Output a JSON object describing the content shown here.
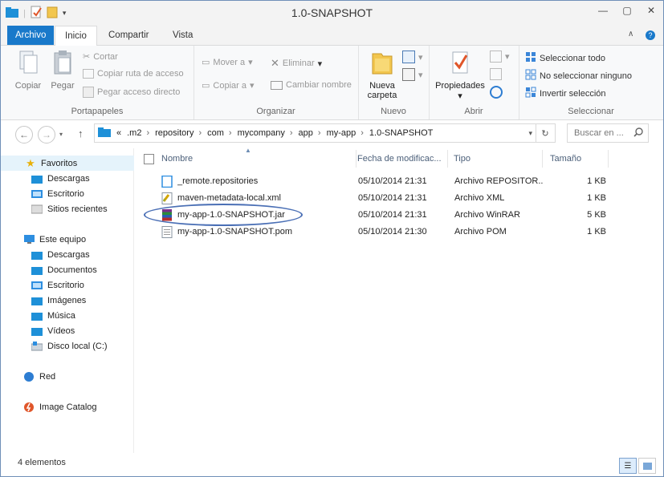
{
  "window": {
    "title": "1.0-SNAPSHOT"
  },
  "ribbon_tabs": {
    "file": "Archivo",
    "home": "Inicio",
    "share": "Compartir",
    "view": "Vista"
  },
  "ribbon": {
    "clipboard": {
      "copy": "Copiar",
      "paste": "Pegar",
      "cut": "Cortar",
      "copy_path": "Copiar ruta de acceso",
      "paste_shortcut": "Pegar acceso directo",
      "label": "Portapapeles"
    },
    "organize": {
      "move_to": "Mover a",
      "copy_to": "Copiar a",
      "delete": "Eliminar",
      "rename": "Cambiar nombre",
      "label": "Organizar"
    },
    "new": {
      "new_folder_line1": "Nueva",
      "new_folder_line2": "carpeta",
      "label": "Nuevo"
    },
    "open": {
      "properties": "Propiedades",
      "label": "Abrir"
    },
    "select": {
      "select_all": "Seleccionar todo",
      "select_none": "No seleccionar ninguno",
      "invert": "Invertir selección",
      "label": "Seleccionar"
    }
  },
  "address": {
    "overflow": "«",
    "crumbs": [
      ".m2",
      "repository",
      "com",
      "mycompany",
      "app",
      "my-app",
      "1.0-SNAPSHOT"
    ],
    "search_placeholder": "Buscar en ..."
  },
  "nav": {
    "favorites": "Favoritos",
    "fav_items": [
      "Descargas",
      "Escritorio",
      "Sitios recientes"
    ],
    "this_pc": "Este equipo",
    "pc_items": [
      "Descargas",
      "Documentos",
      "Escritorio",
      "Imágenes",
      "Música",
      "Vídeos",
      "Disco local (C:)"
    ],
    "network": "Red",
    "image_catalog": "Image Catalog"
  },
  "columns": {
    "name": "Nombre",
    "date": "Fecha de modificac...",
    "type": "Tipo",
    "size": "Tamaño"
  },
  "files": [
    {
      "name": "_remote.repositories",
      "date": "05/10/2014 21:31",
      "type": "Archivo REPOSITOR...",
      "size": "1 KB",
      "icon": "generic-file-icon"
    },
    {
      "name": "maven-metadata-local.xml",
      "date": "05/10/2014 21:31",
      "type": "Archivo XML",
      "size": "1 KB",
      "icon": "xml-file-icon"
    },
    {
      "name": "my-app-1.0-SNAPSHOT.jar",
      "date": "05/10/2014 21:31",
      "type": "Archivo WinRAR",
      "size": "5 KB",
      "icon": "winrar-file-icon"
    },
    {
      "name": "my-app-1.0-SNAPSHOT.pom",
      "date": "05/10/2014 21:30",
      "type": "Archivo POM",
      "size": "1 KB",
      "icon": "pom-file-icon"
    }
  ],
  "status": {
    "count": "4 elementos"
  },
  "colors": {
    "accent": "#1979ca",
    "highlight_ring": "#4a6fb5"
  }
}
